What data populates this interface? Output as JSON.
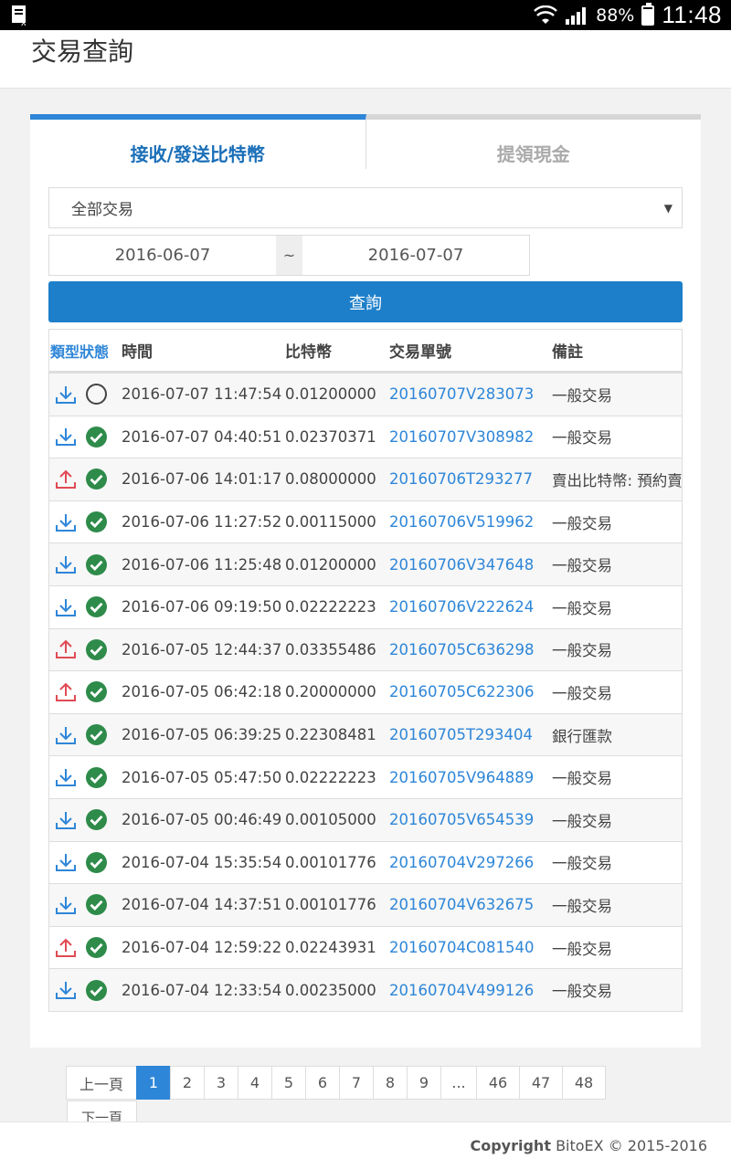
{
  "status_bar": {
    "battery": "88%",
    "time": "11:48"
  },
  "header": {
    "title": "交易查詢"
  },
  "tabs": [
    {
      "label": "接收/發送比特幣",
      "active": true
    },
    {
      "label": "提領現金",
      "active": false
    }
  ],
  "filter": {
    "type_selected": "全部交易",
    "date_from": "2016-06-07",
    "date_separator": "~",
    "date_to": "2016-07-07",
    "query_label": "查詢"
  },
  "table": {
    "columns": [
      "類型狀態",
      "時間",
      "比特幣",
      "交易單號",
      "備註"
    ],
    "rows": [
      {
        "dir": "receive",
        "status": "pending",
        "time": "2016-07-07 11:47:54",
        "btc": "0.01200000",
        "order": "20160707V283073",
        "note": "一般交易"
      },
      {
        "dir": "receive",
        "status": "done",
        "time": "2016-07-07 04:40:51",
        "btc": "0.02370371",
        "order": "20160707V308982",
        "note": "一般交易"
      },
      {
        "dir": "send",
        "status": "done",
        "time": "2016-07-06 14:01:17",
        "btc": "0.08000000",
        "order": "20160706T293277",
        "note": "賣出比特幣: 預約賣"
      },
      {
        "dir": "receive",
        "status": "done",
        "time": "2016-07-06 11:27:52",
        "btc": "0.00115000",
        "order": "20160706V519962",
        "note": "一般交易"
      },
      {
        "dir": "receive",
        "status": "done",
        "time": "2016-07-06 11:25:48",
        "btc": "0.01200000",
        "order": "20160706V347648",
        "note": "一般交易"
      },
      {
        "dir": "receive",
        "status": "done",
        "time": "2016-07-06 09:19:50",
        "btc": "0.02222223",
        "order": "20160706V222624",
        "note": "一般交易"
      },
      {
        "dir": "send",
        "status": "done",
        "time": "2016-07-05 12:44:37",
        "btc": "0.03355486",
        "order": "20160705C636298",
        "note": "一般交易"
      },
      {
        "dir": "send",
        "status": "done",
        "time": "2016-07-05 06:42:18",
        "btc": "0.20000000",
        "order": "20160705C622306",
        "note": "一般交易"
      },
      {
        "dir": "receive",
        "status": "done",
        "time": "2016-07-05 06:39:25",
        "btc": "0.22308481",
        "order": "20160705T293404",
        "note": "銀行匯款"
      },
      {
        "dir": "receive",
        "status": "done",
        "time": "2016-07-05 05:47:50",
        "btc": "0.02222223",
        "order": "20160705V964889",
        "note": "一般交易"
      },
      {
        "dir": "receive",
        "status": "done",
        "time": "2016-07-05 00:46:49",
        "btc": "0.00105000",
        "order": "20160705V654539",
        "note": "一般交易"
      },
      {
        "dir": "receive",
        "status": "done",
        "time": "2016-07-04 15:35:54",
        "btc": "0.00101776",
        "order": "20160704V297266",
        "note": "一般交易"
      },
      {
        "dir": "receive",
        "status": "done",
        "time": "2016-07-04 14:37:51",
        "btc": "0.00101776",
        "order": "20160704V632675",
        "note": "一般交易"
      },
      {
        "dir": "send",
        "status": "done",
        "time": "2016-07-04 12:59:22",
        "btc": "0.02243931",
        "order": "20160704C081540",
        "note": "一般交易"
      },
      {
        "dir": "receive",
        "status": "done",
        "time": "2016-07-04 12:33:54",
        "btc": "0.00235000",
        "order": "20160704V499126",
        "note": "一般交易"
      }
    ]
  },
  "pagination": {
    "prev": "上一頁",
    "pages": [
      "1",
      "2",
      "3",
      "4",
      "5",
      "6",
      "7",
      "8",
      "9",
      "...",
      "46",
      "47",
      "48"
    ],
    "current": "1",
    "next": "下一頁"
  },
  "footer": {
    "copyright_bold": "Copyright",
    "copyright_rest": "BitoEX © 2015-2016"
  },
  "colors": {
    "accent": "#2e86d8",
    "button": "#1d7fca",
    "send": "#e04b55",
    "receive": "#2e86d8",
    "done": "#2e8b4a"
  },
  "icons": {
    "receive": "download-icon",
    "send": "upload-icon",
    "done": "check-circle-icon",
    "pending": "pending-circle-icon"
  }
}
